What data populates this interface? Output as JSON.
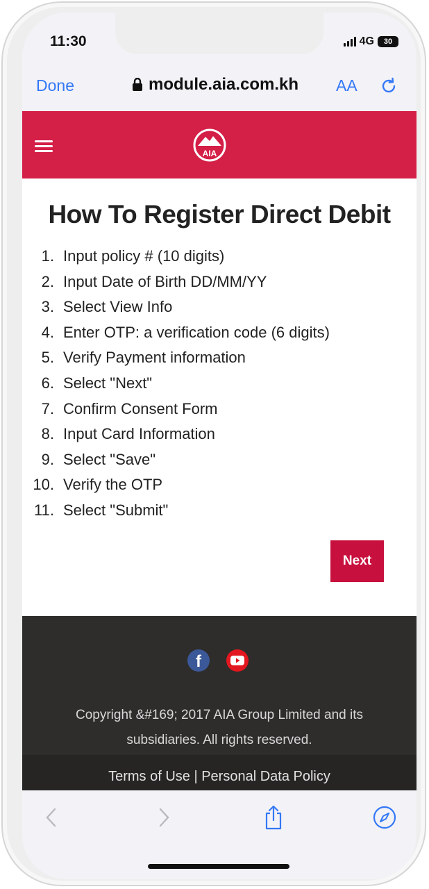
{
  "status_bar": {
    "time": "11:30",
    "network": "4G",
    "battery": "30"
  },
  "browser": {
    "done_label": "Done",
    "url": "module.aia.com.kh",
    "text_size_label": "AA"
  },
  "page": {
    "logo_text": "AIA",
    "title": "How To Register Direct Debit",
    "steps": [
      {
        "num": "1.",
        "text": "Input policy # (10 digits)"
      },
      {
        "num": "2.",
        "text": "Input Date of Birth DD/MM/YY"
      },
      {
        "num": "3.",
        "text": "Select View Info"
      },
      {
        "num": "4.",
        "text": "Enter OTP: a verification code (6 digits)"
      },
      {
        "num": "5.",
        "text": "Verify Payment information"
      },
      {
        "num": "6.",
        "text": "Select \"Next\""
      },
      {
        "num": "7.",
        "text": "Confirm Consent Form"
      },
      {
        "num": "8.",
        "text": "Input Card Information"
      },
      {
        "num": "9.",
        "text": "Select \"Save\""
      },
      {
        "num": "10.",
        "text": "Verify the OTP"
      },
      {
        "num": "11.",
        "text": "Select \"Submit\""
      }
    ],
    "next_label": "Next"
  },
  "footer": {
    "copyright_line1": "Copyright &#169; 2017 AIA Group Limited and its",
    "copyright_line2": "subsidiaries. All rights reserved.",
    "terms": "Terms of Use | Personal Data Policy"
  },
  "colors": {
    "brand_red": "#d41f47",
    "link_blue": "#3478f6",
    "footer_bg": "#2e2d2b"
  },
  "icons": [
    "lock-icon",
    "reload-icon",
    "hamburger-menu-icon",
    "facebook-icon",
    "youtube-icon",
    "back-icon",
    "forward-icon",
    "share-icon",
    "compass-icon"
  ]
}
